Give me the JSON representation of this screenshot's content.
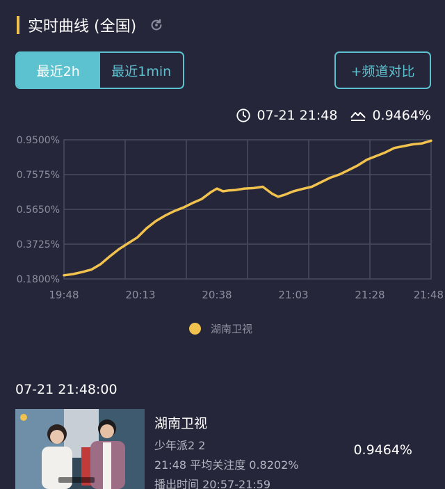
{
  "header": {
    "title": "实时曲线 (全国)"
  },
  "range_tabs": [
    {
      "label": "最近2h",
      "active": true
    },
    {
      "label": "最近1min",
      "active": false
    }
  ],
  "compare_button": {
    "label": "+频道对比"
  },
  "readout": {
    "time": "07-21 21:48",
    "value": "0.9464%"
  },
  "legend": {
    "label": "湖南卫视"
  },
  "detail": {
    "timestamp": "07-21 21:48:00",
    "channel": "湖南卫视",
    "program": "少年派2 2",
    "avg_line": "21:48 平均关注度 0.8202%",
    "airtime": "播出时间 20:57-21:59",
    "value": "0.9464%"
  },
  "colors": {
    "accent": "#f2c24e",
    "teal": "#5cc2cf",
    "background": "#25263a"
  },
  "chart_data": {
    "type": "line",
    "x_tick_labels": [
      "19:48",
      "20:13",
      "20:38",
      "21:03",
      "21:28",
      "21:48"
    ],
    "y_tick_labels": [
      "0.9500%",
      "0.7575%",
      "0.5650%",
      "0.3725%",
      "0.1800%"
    ],
    "ylim": [
      0.18,
      0.95
    ],
    "grid": true,
    "legend_position": "bottom",
    "series": [
      {
        "name": "湖南卫视",
        "color": "#f2c24e",
        "x": [
          "19:48",
          "19:51",
          "19:54",
          "19:57",
          "20:00",
          "20:03",
          "20:06",
          "20:09",
          "20:12",
          "20:15",
          "20:18",
          "20:21",
          "20:24",
          "20:27",
          "20:30",
          "20:33",
          "20:36",
          "20:38",
          "20:40",
          "20:42",
          "20:44",
          "20:47",
          "20:50",
          "20:53",
          "20:56",
          "20:58",
          "21:00",
          "21:03",
          "21:06",
          "21:09",
          "21:12",
          "21:15",
          "21:18",
          "21:21",
          "21:24",
          "21:27",
          "21:30",
          "21:33",
          "21:36",
          "21:39",
          "21:42",
          "21:45",
          "21:48"
        ],
        "values": [
          0.2,
          0.207,
          0.218,
          0.232,
          0.262,
          0.305,
          0.345,
          0.378,
          0.41,
          0.46,
          0.5,
          0.53,
          0.555,
          0.575,
          0.6,
          0.622,
          0.66,
          0.68,
          0.665,
          0.67,
          0.672,
          0.68,
          0.683,
          0.69,
          0.652,
          0.635,
          0.645,
          0.665,
          0.678,
          0.69,
          0.715,
          0.74,
          0.758,
          0.782,
          0.808,
          0.84,
          0.86,
          0.88,
          0.905,
          0.915,
          0.925,
          0.93,
          0.945
        ]
      }
    ]
  }
}
